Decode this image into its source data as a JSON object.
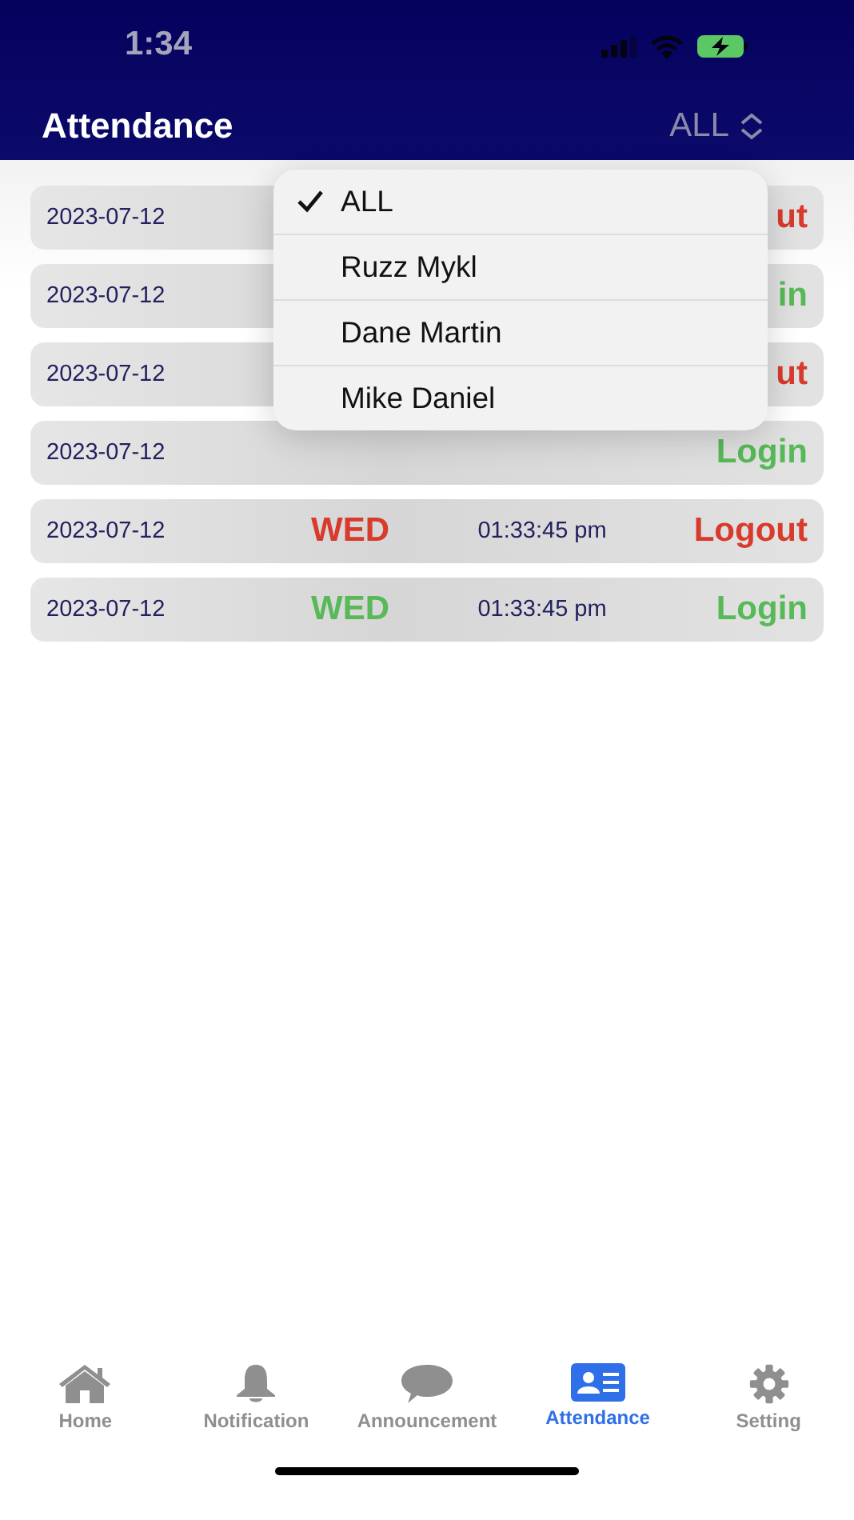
{
  "status_bar": {
    "time": "1:34"
  },
  "header": {
    "title": "Attendance",
    "filter": "ALL"
  },
  "records": [
    {
      "date": "2023-07-12",
      "status": "ut",
      "kind": "logout"
    },
    {
      "date": "2023-07-12",
      "status": "in",
      "kind": "login"
    },
    {
      "date": "2023-07-12",
      "status": "ut",
      "kind": "logout"
    },
    {
      "date": "2023-07-12",
      "status": "Login",
      "kind": "login"
    },
    {
      "date": "2023-07-12",
      "day": "WED",
      "time": "01:33:45 pm",
      "status": "Logout",
      "kind": "logout"
    },
    {
      "date": "2023-07-12",
      "day": "WED",
      "time": "01:33:45 pm",
      "status": "Login",
      "kind": "login"
    }
  ],
  "filter_menu": {
    "options": [
      {
        "label": "ALL",
        "selected": true
      },
      {
        "label": "Ruzz Mykl",
        "selected": false
      },
      {
        "label": "Dane Martin",
        "selected": false
      },
      {
        "label": "Mike Daniel",
        "selected": false
      }
    ]
  },
  "tabs": [
    {
      "label": "Home",
      "selected": false
    },
    {
      "label": "Notification",
      "selected": false
    },
    {
      "label": "Announcement",
      "selected": false
    },
    {
      "label": "Attendance",
      "selected": true
    },
    {
      "label": "Setting",
      "selected": false
    }
  ]
}
